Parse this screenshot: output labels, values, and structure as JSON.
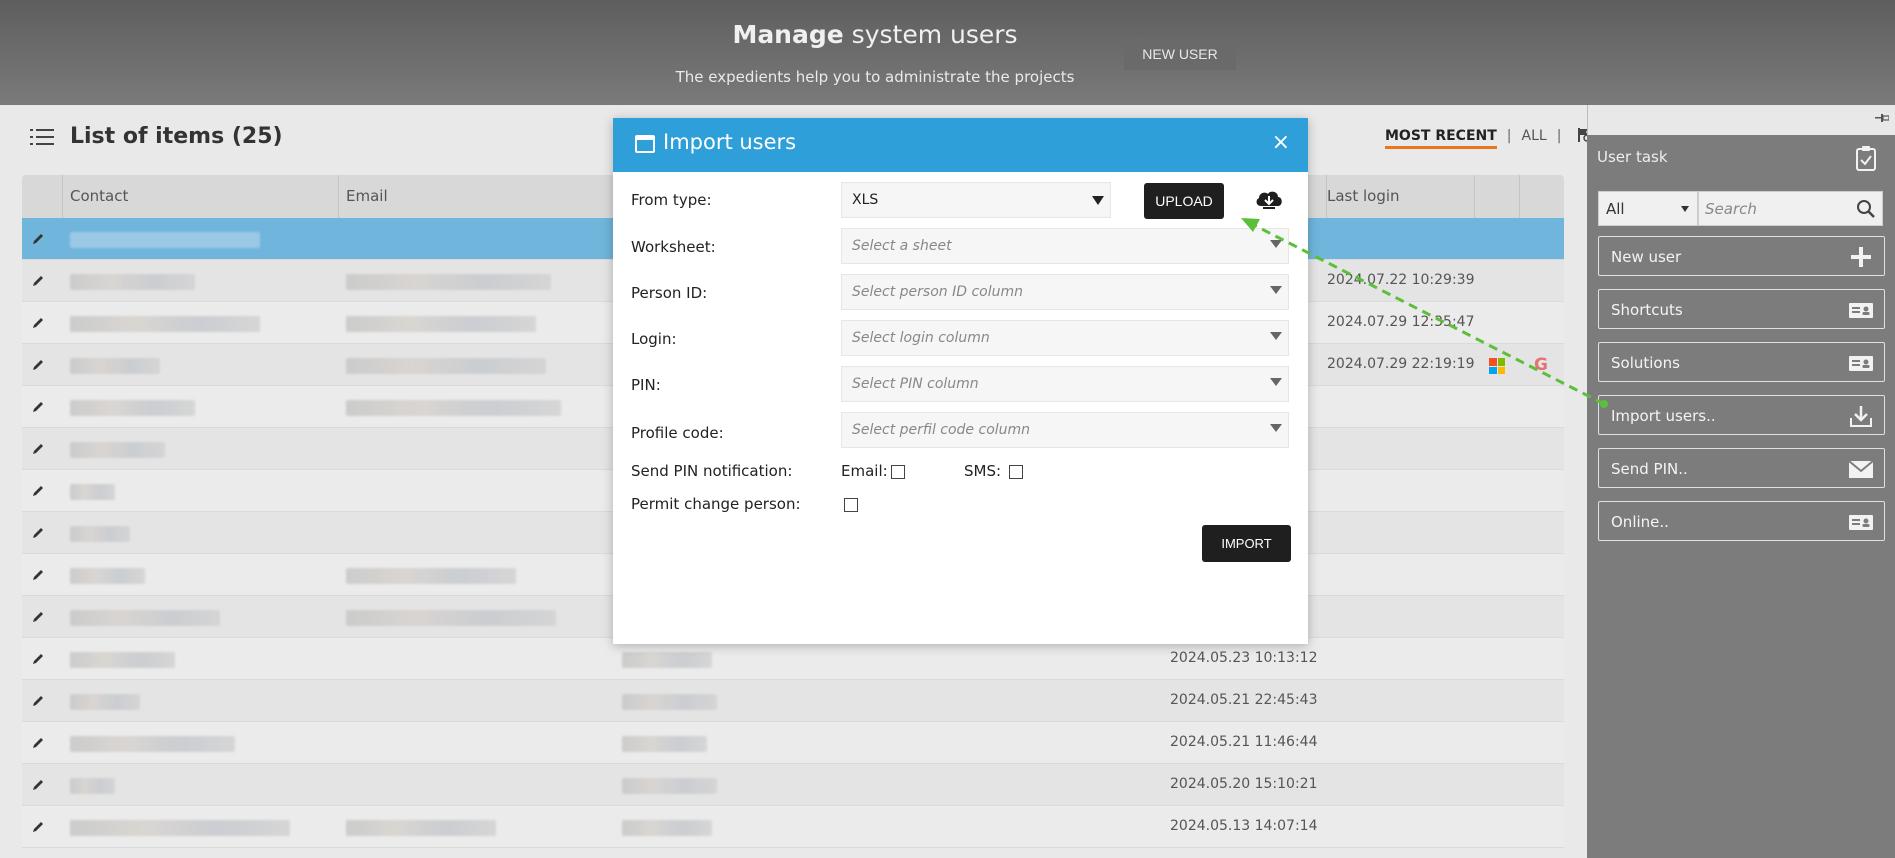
{
  "header": {
    "title_bold": "Manage",
    "title_rest": " system users",
    "subtitle": "The expedients help you to administrate the projects",
    "new_user_label": "NEW USER"
  },
  "list": {
    "title": "List of items (25)",
    "filters": {
      "most_recent": "MOST RECENT",
      "all": "ALL",
      "separator": "|"
    },
    "columns": {
      "contact": "Contact",
      "email": "Email",
      "last_login": "Last login"
    },
    "rows": [
      {
        "selected": true,
        "date": "",
        "date2": ""
      },
      {
        "date": "",
        "date2": "2024.07.22 10:29:39"
      },
      {
        "date": "",
        "date2": "2024.07.29 12:35:47"
      },
      {
        "date": "",
        "date2": "2024.07.29 22:19:19",
        "ms": true,
        "google": true
      },
      {
        "date": "",
        "date2": ""
      },
      {
        "date": "",
        "date2": ""
      },
      {
        "date": "",
        "date2": ""
      },
      {
        "date": "",
        "date2": ""
      },
      {
        "date": "",
        "date2": ""
      },
      {
        "date": "",
        "date2": ""
      },
      {
        "date": "2024.05.23 10:13:12",
        "date2": ""
      },
      {
        "date": "2024.05.21 22:45:43",
        "date2": ""
      },
      {
        "date": "2024.05.21 11:46:44",
        "date2": ""
      },
      {
        "date": "2024.05.20 15:10:21",
        "date2": ""
      },
      {
        "date": "2024.05.13 14:07:14",
        "date2": ""
      }
    ]
  },
  "modal": {
    "title": "Import users",
    "close_glyph": "×",
    "from_type_label": "From type:",
    "from_type_value": "XLS",
    "upload_label": "UPLOAD",
    "worksheet_label": "Worksheet:",
    "worksheet_placeholder": "Select a sheet",
    "person_id_label": "Person ID:",
    "person_id_placeholder": "Select person ID column",
    "login_label": "Login:",
    "login_placeholder": "Select login column",
    "pin_label": "PIN:",
    "pin_placeholder": "Select PIN column",
    "profile_label": "Profile code:",
    "profile_placeholder": "Select perfil code column",
    "send_pin_label": "Send PIN notification:",
    "email_label": "Email:",
    "sms_label": "SMS:",
    "permit_label": "Permit change person:",
    "import_label": "IMPORT"
  },
  "sidebar": {
    "title": "User task",
    "filter_value": "All",
    "search_placeholder": "Search",
    "buttons": [
      {
        "label": "New user",
        "icon": "plus-icon"
      },
      {
        "label": "Shortcuts",
        "icon": "card-icon"
      },
      {
        "label": "Solutions",
        "icon": "card-icon"
      },
      {
        "label": "Import users..",
        "icon": "download-icon"
      },
      {
        "label": "Send PIN..",
        "icon": "envelope-icon"
      },
      {
        "label": "Online..",
        "icon": "card-icon"
      }
    ]
  },
  "colors": {
    "modal_header": "#2e9fd8",
    "selected_row": "#6fb5dc",
    "accent_underline": "#e87722",
    "annotation_arrow": "#5cbf3a"
  }
}
